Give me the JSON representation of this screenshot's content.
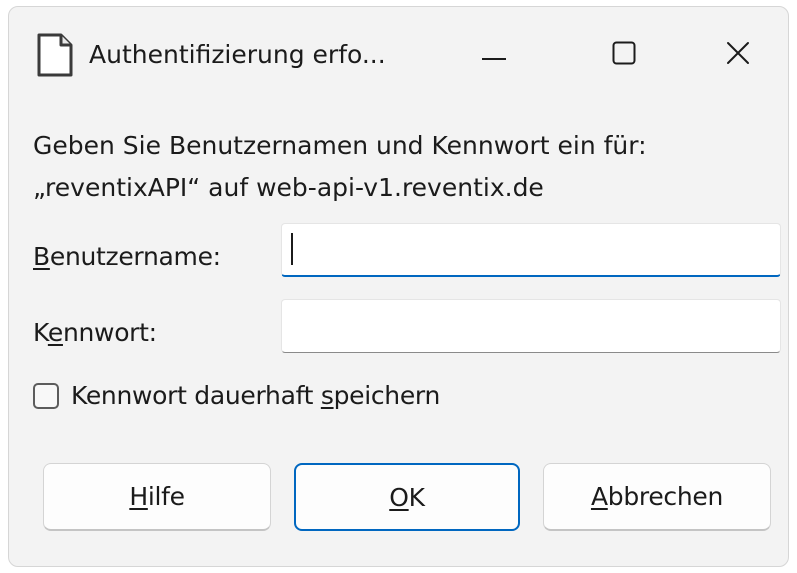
{
  "window": {
    "title": "Authentifizierung erfo...",
    "controls": {
      "minimize": "minimize-icon",
      "maximize": "maximize-icon",
      "close": "close-icon"
    }
  },
  "prompt": {
    "line1": "Geben Sie Benutzernamen und Kennwort ein für:",
    "line2": "„reventixAPI“ auf web-api-v1.reventix.de"
  },
  "fields": {
    "username": {
      "label_accel": "B",
      "label_rest": "enutzername:",
      "value": ""
    },
    "password": {
      "label_pre": "K",
      "label_accel": "e",
      "label_rest": "nnwort:",
      "value": ""
    }
  },
  "remember": {
    "label_pre": "Kennwort dauerhaft ",
    "label_accel": "s",
    "label_rest": "peichern",
    "checked": false
  },
  "buttons": {
    "help": {
      "accel": "H",
      "rest": "ilfe"
    },
    "ok": {
      "accel": "O",
      "rest": "K"
    },
    "cancel": {
      "accel": "A",
      "rest": "bbrechen"
    }
  },
  "colors": {
    "accent": "#0067c0",
    "window_bg": "#f3f3f3"
  }
}
